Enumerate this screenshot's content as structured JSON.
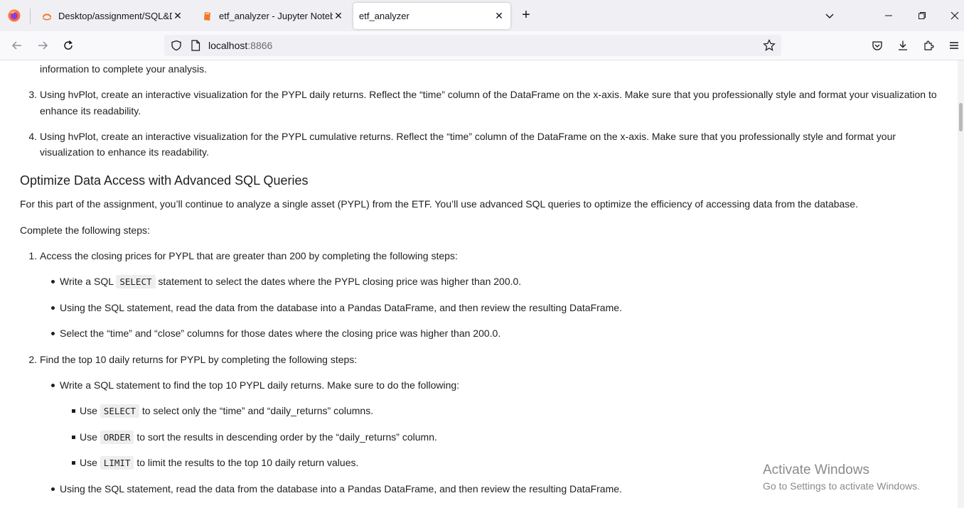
{
  "browser": {
    "tabs": [
      {
        "label": "Desktop/assignment/SQL&DAT"
      },
      {
        "label": "etf_analyzer - Jupyter Notebook"
      },
      {
        "label": "etf_analyzer"
      }
    ],
    "url_host": "localhost",
    "url_port": ":8866"
  },
  "doc": {
    "top_line": "information to complete your analysis.",
    "item3_num": "3.",
    "item3_l1": "Using hvPlot, create an interactive visualization for the PYPL daily returns. Reflect the “time” column of the DataFrame on the x-axis. Make sure that you professionally style and format your visualization to",
    "item3_l2": "enhance its readability.",
    "item4_num": "4.",
    "item4_l1": "Using hvPlot, create an interactive visualization for the PYPL cumulative returns. Reflect the “time” column of the DataFrame on the x-axis. Make sure that you professionally style and format your",
    "item4_l2": "visualization to enhance its readability.",
    "heading": "Optimize Data Access with Advanced SQL Queries",
    "intro": "For this part of the assignment, you’ll continue to analyze a single asset (PYPL) from the ETF. You’ll use advanced SQL queries to optimize the efficiency of accessing data from the database.",
    "steps_intro": "Complete the following steps:",
    "s1_num": "1.",
    "s1": "Access the closing prices for PYPL that are greater than 200 by completing the following steps:",
    "s1_b1_pre": "Write a SQL ",
    "s1_b1_code": "SELECT",
    "s1_b1_post": " statement to select the dates where the PYPL closing price was higher than 200.0.",
    "s1_b2": "Using the SQL statement, read the data from the database into a Pandas DataFrame, and then review the resulting DataFrame.",
    "s1_b3": "Select the “time” and “close” columns for those dates where the closing price was higher than 200.0.",
    "s2_num": "2.",
    "s2": "Find the top 10 daily returns for PYPL by completing the following steps:",
    "s2_b1": "Write a SQL statement to find the top 10 PYPL daily returns. Make sure to do the following:",
    "s2_sq1_pre": "Use ",
    "s2_sq1_code": "SELECT",
    "s2_sq1_post": " to select only the “time” and “daily_returns” columns.",
    "s2_sq2_pre": "Use ",
    "s2_sq2_code": "ORDER",
    "s2_sq2_post": " to sort the results in descending order by the “daily_returns” column.",
    "s2_sq3_pre": "Use ",
    "s2_sq3_code": "LIMIT",
    "s2_sq3_post": " to limit the results to the top 10 daily return values.",
    "s2_b2": "Using the SQL statement, read the data from the database into a Pandas DataFrame, and then review the resulting DataFrame."
  },
  "watermark": {
    "line1": "Activate Windows",
    "line2": "Go to Settings to activate Windows."
  }
}
